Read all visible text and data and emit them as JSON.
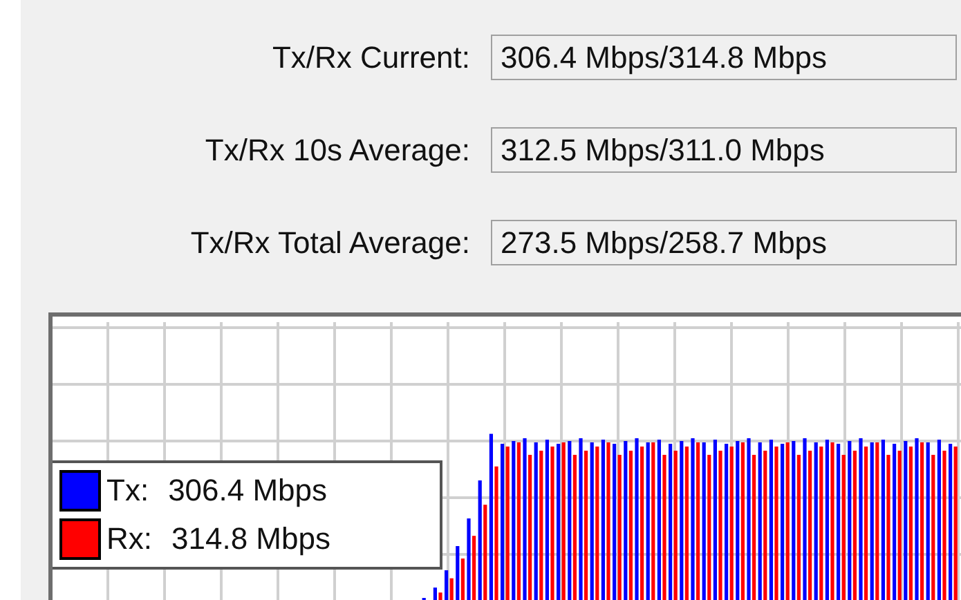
{
  "stats": [
    {
      "label": "Tx/Rx Current:",
      "value": "306.4 Mbps/314.8 Mbps"
    },
    {
      "label": "Tx/Rx 10s Average:",
      "value": "312.5 Mbps/311.0 Mbps"
    },
    {
      "label": "Tx/Rx Total Average:",
      "value": "273.5 Mbps/258.7 Mbps"
    }
  ],
  "graph": {
    "legend": [
      {
        "label": "Tx:",
        "value": "306.4 Mbps",
        "color": "#0000ff"
      },
      {
        "label": "Rx:",
        "value": "314.8 Mbps",
        "color": "#ff0000"
      }
    ]
  }
}
